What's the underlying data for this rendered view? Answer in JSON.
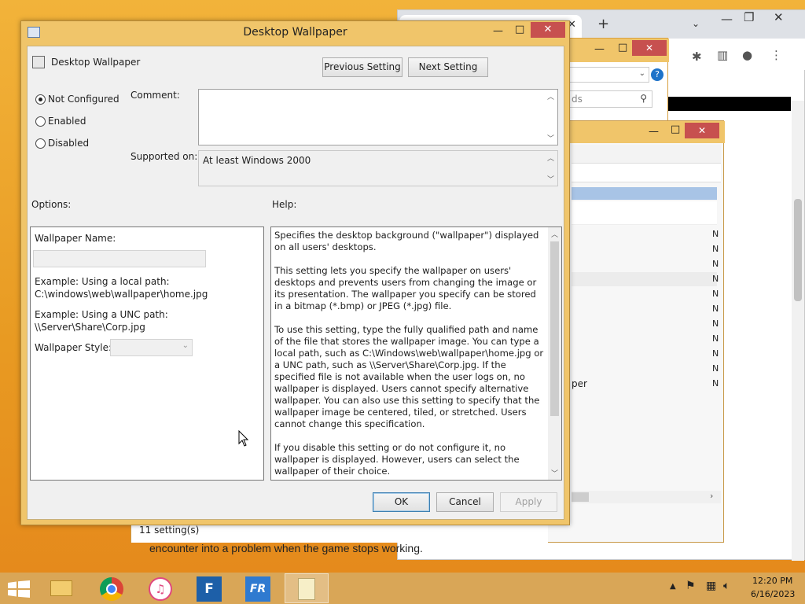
{
  "dialog": {
    "title": "Desktop Wallpaper",
    "policy_name": "Desktop Wallpaper",
    "prev_button": "Previous Setting",
    "next_button": "Next Setting",
    "radio_not_configured": "Not Configured",
    "radio_enabled": "Enabled",
    "radio_disabled": "Disabled",
    "selected_option": "Not Configured",
    "comment_label": "Comment:",
    "comment_value": "",
    "supported_label": "Supported on:",
    "supported_value": "At least Windows 2000",
    "options_label": "Options:",
    "help_label": "Help:",
    "options": {
      "wallpaper_name_label": "Wallpaper Name:",
      "wallpaper_name_value": "",
      "example_local_1": "Example: Using a local path:",
      "example_local_2": "C:\\windows\\web\\wallpaper\\home.jpg",
      "example_unc_1": "Example: Using a UNC path:",
      "example_unc_2": "\\\\Server\\Share\\Corp.jpg",
      "style_label": "Wallpaper Style:",
      "style_value": ""
    },
    "help_paragraphs": [
      "Specifies the desktop background (\"wallpaper\") displayed on all users' desktops.",
      "This setting lets you specify the wallpaper on users' desktops and prevents users from changing the image or its presentation. The wallpaper you specify can be stored in a bitmap (*.bmp) or JPEG (*.jpg) file.",
      "To use this setting, type the fully qualified path and name of the file that stores the wallpaper image. You can type a local path, such as C:\\Windows\\web\\wallpaper\\home.jpg or a UNC path, such as \\\\Server\\Share\\Corp.jpg. If the specified file is not available when the user logs on, no wallpaper is displayed. Users cannot specify alternative wallpaper. You can also use this setting to specify that the wallpaper image be centered, tiled, or stretched. Users cannot change this specification.",
      "If you disable this setting or do not configure it, no wallpaper is displayed. However, users can select the wallpaper of their choice."
    ],
    "ok_button": "OK",
    "cancel_button": "Cancel",
    "apply_button": "Apply"
  },
  "background": {
    "gpe_status": "11 setting(s)",
    "gpe_partial_item": "per",
    "gpe_state_mark": "N",
    "chrome_search_partial": "ds",
    "article_text": "encounter into a problem when the game stops working."
  },
  "taskbar": {
    "time": "12:20 PM",
    "date": "6/16/2023",
    "icons": [
      "windows-start-icon",
      "file-explorer-icon",
      "chrome-icon",
      "itunes-icon",
      "fr-app-icon",
      "fr2-app-icon",
      "notepad-icon"
    ]
  },
  "colors": {
    "desktop": "#e89a22",
    "window_frame": "#f0c56a",
    "close_button": "#c7504f",
    "taskbar": "#d9a657"
  }
}
